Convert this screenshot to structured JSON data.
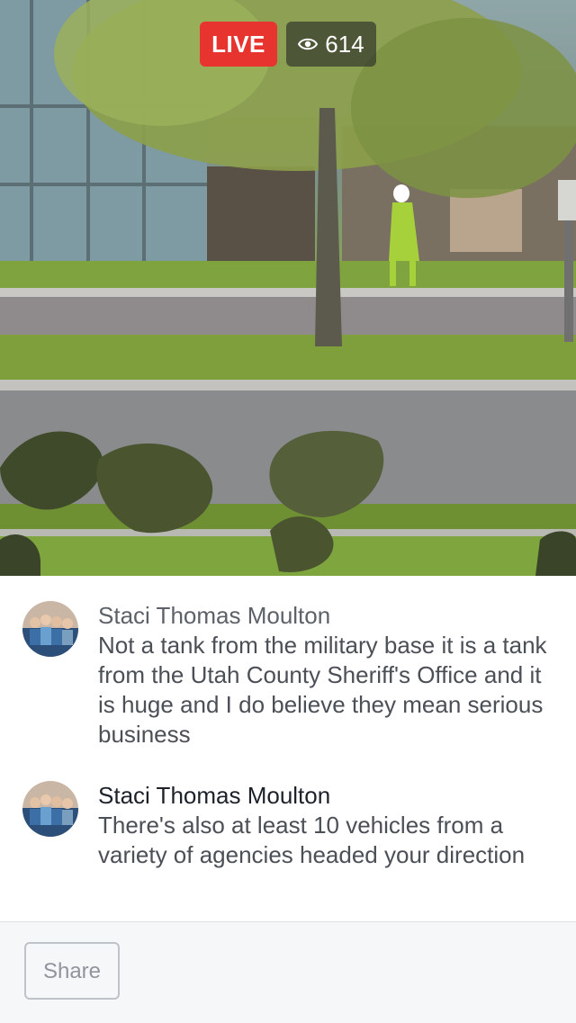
{
  "video": {
    "live_label": "LIVE",
    "viewer_count": "614",
    "icons": {
      "viewers": "eye-icon"
    }
  },
  "comments": [
    {
      "author": "Staci Thomas Moulton",
      "text": "Not a tank from the military base it is a tank from the Utah County Sheriff's Office and it is huge and I do believe they mean serious business"
    },
    {
      "author": "Staci Thomas Moulton",
      "text": "There's also at least 10 vehicles from a variety of agencies headed your direction"
    }
  ],
  "footer": {
    "share_label": "Share"
  },
  "colors": {
    "live_badge": "#e8342f",
    "share_border": "#bec3c9",
    "footer_bg": "#f6f7f9"
  }
}
